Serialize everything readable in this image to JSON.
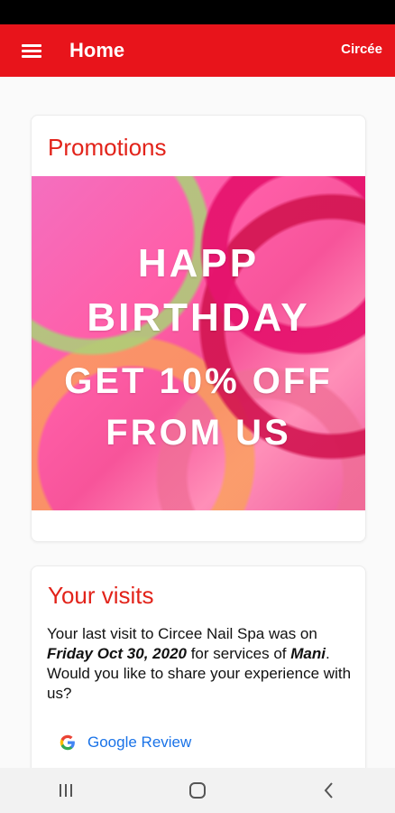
{
  "app_bar": {
    "title": "Home",
    "brand": "Circée",
    "menu_icon": "hamburger-menu-icon",
    "color": "#e8141b"
  },
  "promotions": {
    "title": "Promotions",
    "banner_lines": [
      "HAPP",
      "BIRTHDAY",
      "GET 10% OFF",
      "FROM US"
    ]
  },
  "visits": {
    "title": "Your visits",
    "text_prefix": "Your last visit to Circee Nail Spa was on ",
    "visit_date": "Friday Oct 30, 2020",
    "text_middle": " for services of ",
    "service": "Mani",
    "text_suffix": ". Would you like to share your experience with us?",
    "google_review_label": "Google Review",
    "google_icon": "google-g-icon"
  },
  "nav_bar": {
    "recents_icon": "recents-icon",
    "home_icon": "home-circle-icon",
    "back_icon": "back-chevron-icon"
  },
  "colors": {
    "accent": "#e2231a",
    "link": "#1a73e8"
  }
}
